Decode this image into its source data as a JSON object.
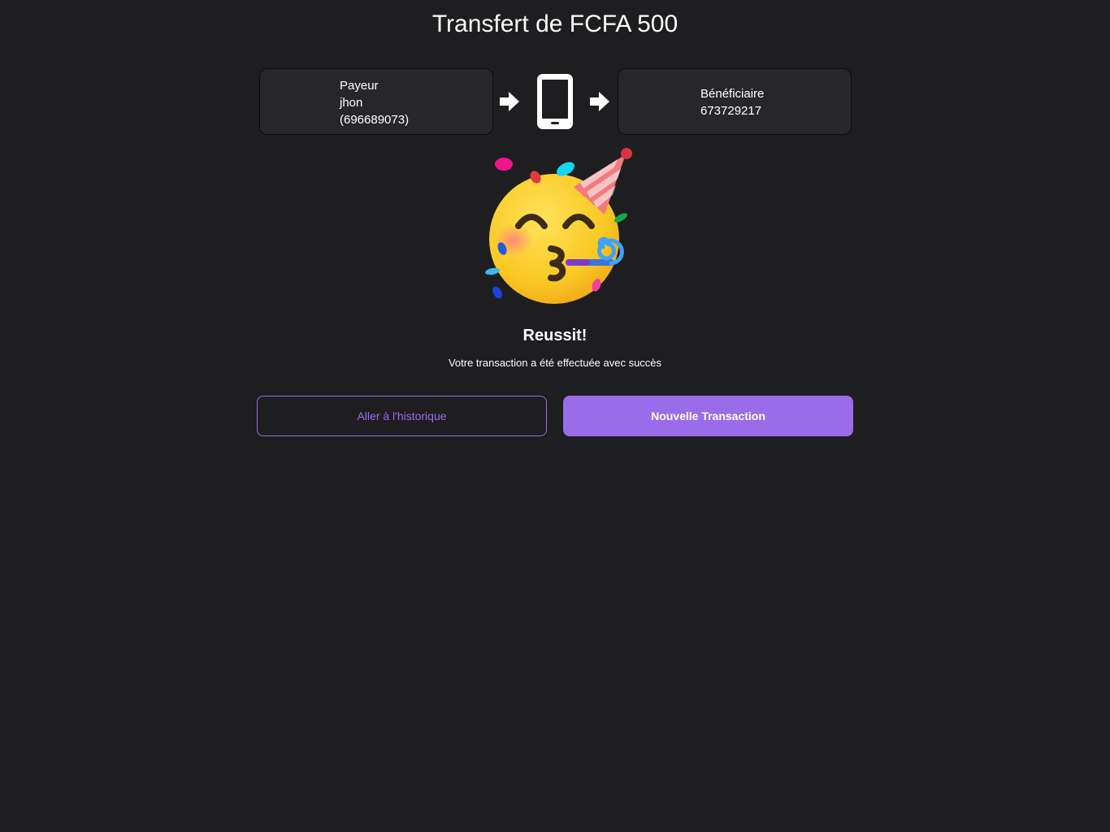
{
  "page": {
    "title": "Transfert de FCFA 500"
  },
  "payer": {
    "label": "Payeur",
    "name": "jhon",
    "phone": "(696689073)"
  },
  "payee": {
    "label": "Bénéficiaire",
    "phone": "673729217"
  },
  "icons": {
    "arrow": "arrow-right-icon",
    "device": "smartphone-icon",
    "celebration": "partying-face-emoji"
  },
  "result": {
    "title": "Reussit!",
    "message": "Votre transaction a été effectuée avec succès"
  },
  "actions": {
    "history_label": "Aller à l'historique",
    "new_label": "Nouvelle Transaction"
  },
  "colors": {
    "background": "#1e1d20",
    "card": "#27262a",
    "accent": "#9b6cea"
  }
}
